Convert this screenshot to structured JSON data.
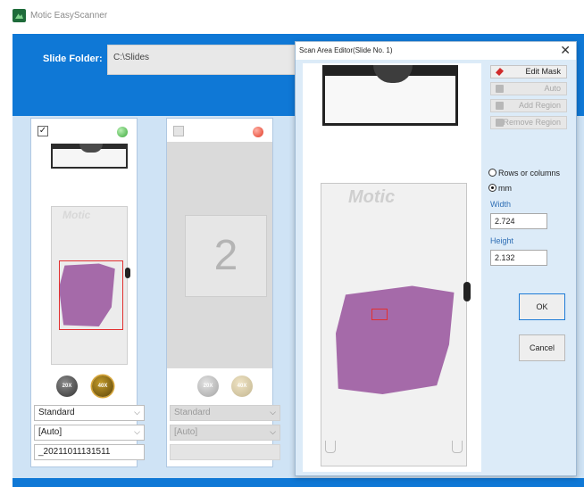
{
  "window": {
    "title": "Motic EasyScanner",
    "icon": "motic-app-icon"
  },
  "header": {
    "folder_label": "Slide Folder:",
    "folder_value": "C:\\Slides"
  },
  "slots": [
    {
      "checked_mark": "✓",
      "status_color": "#3aa83a",
      "slide_logo": "Motic",
      "btn_20x": "20X",
      "btn_40x": "40X",
      "scan_mode": "Standard",
      "focus_mode": "[Auto]",
      "slide_name": "_20211011131511"
    },
    {
      "number": "2",
      "status_color": "#e23a25",
      "btn_20x": "20X",
      "btn_40x": "40X",
      "scan_mode": "Standard",
      "focus_mode": "[Auto]",
      "slide_name": ""
    }
  ],
  "dialog": {
    "title": "Scan Area Editor(Slide No. 1)",
    "close_glyph": "✕",
    "slide_logo": "Motic",
    "buttons": {
      "edit_mask": "Edit Mask",
      "auto": "Auto",
      "add_region": "Add Region",
      "remove_region": "Remove Region"
    },
    "radio_rows_cols": "Rows or columns",
    "radio_mm": "mm",
    "width_label": "Width",
    "width_value": "2.724",
    "height_label": "Height",
    "height_value": "2.132",
    "ok_label": "OK",
    "cancel_label": "Cancel"
  },
  "colors": {
    "header_blue": "#0f78d6",
    "panel_bg": "#cfe3f5",
    "tissue": "#a56aa9",
    "roi_red": "#e23030"
  }
}
